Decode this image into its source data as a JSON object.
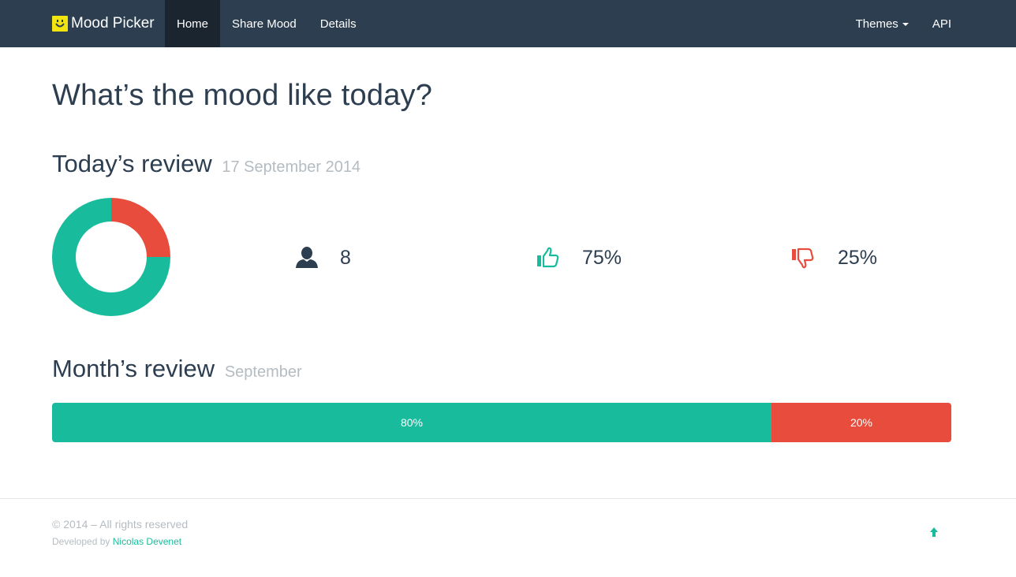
{
  "navbar": {
    "brand": "Mood Picker",
    "items": [
      {
        "label": "Home",
        "active": true
      },
      {
        "label": "Share Mood",
        "active": false
      },
      {
        "label": "Details",
        "active": false
      }
    ],
    "right_items": [
      {
        "label": "Themes"
      },
      {
        "label": "API"
      }
    ]
  },
  "page": {
    "title": "What’s the mood like today?"
  },
  "today": {
    "title": "Today’s review",
    "date": "17 September 2014",
    "chart_data": {
      "type": "pie",
      "categories": [
        "good",
        "bad"
      ],
      "values": [
        75,
        25
      ],
      "colors": [
        "#18bc9c",
        "#e74c3c"
      ]
    },
    "users": "8",
    "good": "75%",
    "bad": "25%"
  },
  "month": {
    "title": "Month’s review",
    "month": "September",
    "good_label": "80%",
    "bad_label": "20%",
    "good_value": 80,
    "bad_value": 20
  },
  "footer": {
    "copyright": "© 2014 – All rights reserved",
    "developed_prefix": "Developed by",
    "developer": "Nicolas Devenet"
  },
  "colors": {
    "navbar": "#2c3e50",
    "good": "#18bc9c",
    "bad": "#e74c3c",
    "muted": "#b4bcc2",
    "logo": "#f1e40f"
  },
  "icons": {
    "brand": "smiley-icon",
    "users": "user-icon",
    "good": "thumbs-up-icon",
    "bad": "thumbs-down-icon",
    "top": "arrow-up-icon"
  }
}
